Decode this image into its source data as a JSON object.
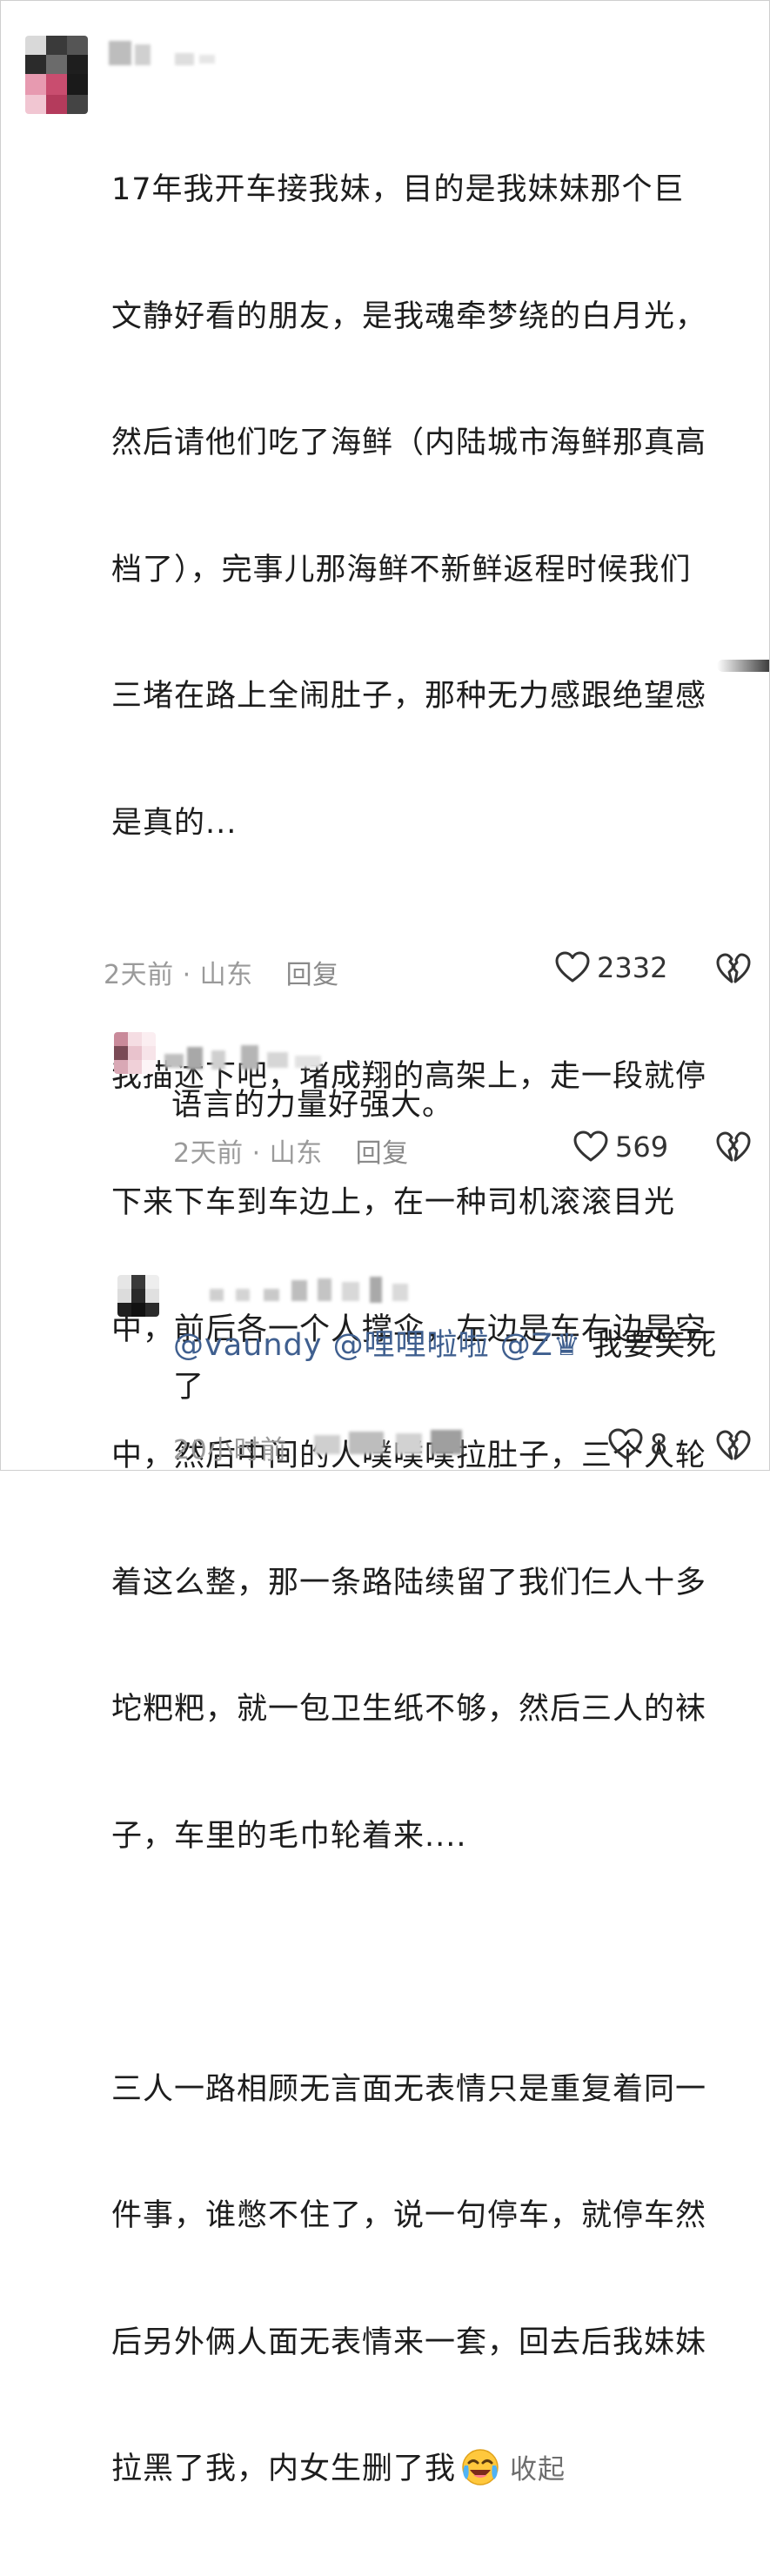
{
  "main_comment": {
    "paragraphs": [
      "17年我开车接我妹，目的是我妹妹那个巨文静好看的朋友，是我魂牵梦绕的白月光，然后请他们吃了海鲜（内陆城市海鲜那真高档了），完事儿那海鲜不新鲜返程时候我们三堵在路上全闹肚子，那种无力感跟绝望感是真的...",
      "我描述下吧，堵成翔的高架上，走一段就停下来下车到车边上，在一种司机滚滚目光中，前后各一个人撑伞，左边是车右边是空中，然后中间的人噗噗噗拉肚子，三个人轮着这么整，那一条路陆续留了我们仨人十多坨粑粑，就一包卫生纸不够，然后三人的袜子，车里的毛巾轮着来....",
      "三人一路相顾无言面无表情只是重复着同一件事，谁憋不住了，说一句停车，就停车然后另外俩人面无表情来一套，回去后我妹妹拉黑了我，内女生删了我"
    ],
    "lines": [
      "17年我开车接我妹，目的是我妹妹那个巨",
      "文静好看的朋友，是我魂牵梦绕的白月光，",
      "然后请他们吃了海鲜（内陆城市海鲜那真高",
      "档了），完事儿那海鲜不新鲜返程时候我们",
      "三堵在路上全闹肚子，那种无力感跟绝望感",
      "是真的...",
      "我描述下吧，堵成翔的高架上，走一段就停",
      "下来下车到车边上，在一种司机滚滚目光",
      "中，前后各一个人撑伞，左边是车右边是空",
      "中，然后中间的人噗噗噗拉肚子，三个人轮",
      "着这么整，那一条路陆续留了我们仨人十多",
      "坨粑粑，就一包卫生纸不够，然后三人的袜",
      "子，车里的毛巾轮着来....",
      "三人一路相顾无言面无表情只是重复着同一",
      "件事，谁憋不住了，说一句停车，就停车然",
      "后另外俩人面无表情来一套，回去后我妹妹",
      "拉黑了我，内女生删了我"
    ],
    "emoji": "laughing-crying-emoji",
    "collapse_label": "收起",
    "time": "2天前",
    "location": "山东",
    "dot": "·",
    "reply_label": "回复",
    "likes": "2332"
  },
  "reply1": {
    "text": "语言的力量好强大。",
    "time": "2天前",
    "location": "山东",
    "dot": "·",
    "reply_label": "回复",
    "likes": "569"
  },
  "reply2": {
    "mention1": "@vaundy",
    "mention2": "@哩哩啦啦",
    "mention3": "@Z♛",
    "text_line1": "我要笑死",
    "text_line2": "了",
    "time": "20小时前",
    "likes": "8"
  },
  "colors": {
    "text": "#1d1d1d",
    "meta": "#9a9a9a",
    "mention": "#3f5f8f",
    "background": "#ffffff"
  }
}
